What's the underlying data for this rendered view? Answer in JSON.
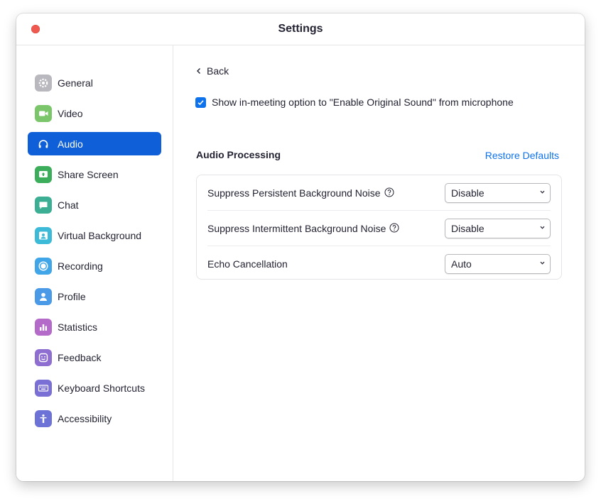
{
  "window": {
    "title": "Settings"
  },
  "colors": {
    "accent": "#0e5fd8",
    "link": "#0e72ed",
    "close": "#ee5a50"
  },
  "sidebar": {
    "items": [
      {
        "label": "General",
        "icon": "gear-icon",
        "color": "#b8b8be"
      },
      {
        "label": "Video",
        "icon": "video-camera-icon",
        "color": "#7bc66a"
      },
      {
        "label": "Audio",
        "icon": "headphones-icon",
        "color": "#0e5fd8",
        "active": true
      },
      {
        "label": "Share Screen",
        "icon": "share-screen-icon",
        "color": "#3cad5b"
      },
      {
        "label": "Chat",
        "icon": "chat-bubble-icon",
        "color": "#3cae94"
      },
      {
        "label": "Virtual Background",
        "icon": "person-background-icon",
        "color": "#3dbad8"
      },
      {
        "label": "Recording",
        "icon": "record-icon",
        "color": "#40a6e8"
      },
      {
        "label": "Profile",
        "icon": "person-icon",
        "color": "#4a9ae8"
      },
      {
        "label": "Statistics",
        "icon": "bar-chart-icon",
        "color": "#b36ac8"
      },
      {
        "label": "Feedback",
        "icon": "smiley-icon",
        "color": "#8e6ed0"
      },
      {
        "label": "Keyboard Shortcuts",
        "icon": "keyboard-icon",
        "color": "#7a6fd4"
      },
      {
        "label": "Accessibility",
        "icon": "accessibility-icon",
        "color": "#6c72d6"
      }
    ]
  },
  "main": {
    "back_label": "Back",
    "original_sound_option": {
      "label": "Show in-meeting option to \"Enable Original Sound\" from microphone",
      "checked": true
    },
    "audio_processing": {
      "title": "Audio Processing",
      "restore_label": "Restore Defaults",
      "rows": [
        {
          "label": "Suppress Persistent Background Noise",
          "value": "Disable",
          "help": true
        },
        {
          "label": "Suppress Intermittent Background Noise",
          "value": "Disable",
          "help": true
        },
        {
          "label": "Echo Cancellation",
          "value": "Auto",
          "help": false
        }
      ]
    }
  }
}
